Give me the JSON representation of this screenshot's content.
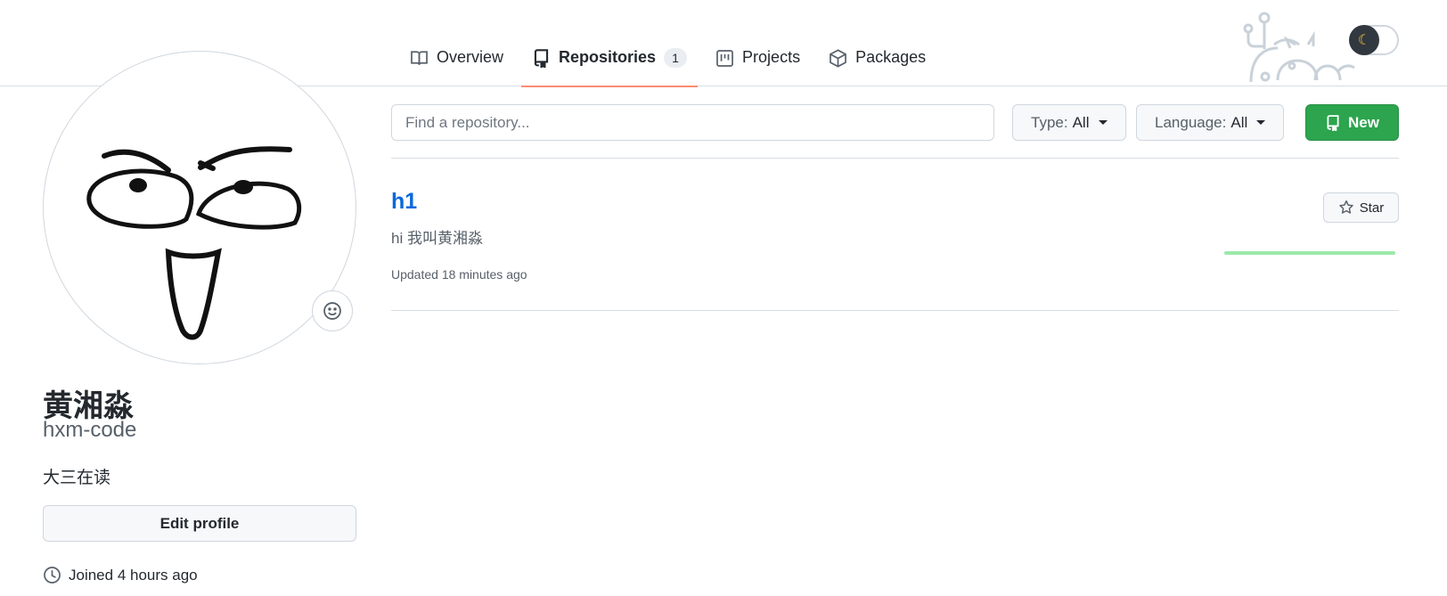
{
  "nav": {
    "tabs": [
      {
        "label": "Overview",
        "icon": "book-icon"
      },
      {
        "label": "Repositories",
        "icon": "repo-icon",
        "count": "1"
      },
      {
        "label": "Projects",
        "icon": "project-icon"
      },
      {
        "label": "Packages",
        "icon": "package-icon"
      }
    ],
    "active_tab": "Repositories",
    "underline_color": "#fd8c73"
  },
  "profile": {
    "fullname": "黄湘淼",
    "login": "hxm-code",
    "bio": "大三在读",
    "edit_label": "Edit profile",
    "joined": "Joined 4 hours ago",
    "avatar_icon": "face-drawing",
    "emoji_icon": "smiley-icon"
  },
  "filters": {
    "search_placeholder": "Find a repository...",
    "type_label": "Type:",
    "type_value": "All",
    "language_label": "Language:",
    "language_value": "All",
    "new_label": "New",
    "new_color": "#2da44e"
  },
  "repos": [
    {
      "name": "h1",
      "description": "hi 我叫黄湘淼",
      "updated": "Updated 18 minutes ago",
      "star_label": "Star"
    }
  ],
  "theme": {
    "mode": "dark-toggle",
    "icon": "moon-icon"
  },
  "colors": {
    "link": "#0969da",
    "muted": "#57606a",
    "border": "#d0d7de"
  }
}
